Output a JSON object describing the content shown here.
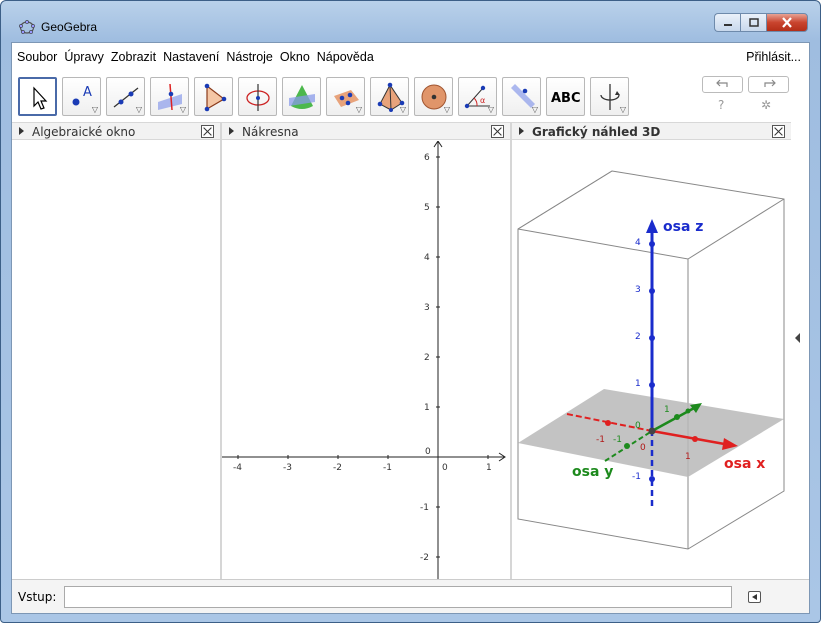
{
  "window": {
    "title": "GeoGebra",
    "icon": "geogebra-logo-icon"
  },
  "menu": {
    "items": [
      "Soubor",
      "Úpravy",
      "Zobrazit",
      "Nastavení",
      "Nástroje",
      "Okno",
      "Nápověda"
    ],
    "login": "Přihlásit..."
  },
  "toolbar": {
    "tools": [
      {
        "icon": "move-arrow-icon",
        "selected": true
      },
      {
        "icon": "point-icon"
      },
      {
        "icon": "line-icon"
      },
      {
        "icon": "perpendicular-line-icon"
      },
      {
        "icon": "polygon-icon"
      },
      {
        "icon": "circle-icon"
      },
      {
        "icon": "intersect-surfaces-icon"
      },
      {
        "icon": "plane-icon"
      },
      {
        "icon": "pyramid-icon"
      },
      {
        "icon": "sphere-icon"
      },
      {
        "icon": "angle-icon"
      },
      {
        "icon": "reflect-icon"
      },
      {
        "icon": "text-icon",
        "label": "ABC"
      },
      {
        "icon": "rotate-view-icon"
      }
    ],
    "undo_icon": "undo-icon",
    "redo_icon": "redo-icon",
    "help_symbol": "?",
    "settings_icon": "gear-icon"
  },
  "panels": {
    "algebra": {
      "title": "Algebraické okno"
    },
    "graphics": {
      "title": "Nákresna"
    },
    "graphics3d": {
      "title": "Grafický náhled 3D"
    }
  },
  "graphics2d": {
    "x_ticks": [
      "-4",
      "-3",
      "-2",
      "-1",
      "0",
      "1"
    ],
    "y_ticks": [
      "6",
      "5",
      "4",
      "3",
      "2",
      "1",
      "0",
      "-1",
      "-2"
    ]
  },
  "graphics3d": {
    "axis_x": "osa x",
    "axis_y": "osa y",
    "axis_z": "osa z",
    "z_ticks": [
      "4",
      "3",
      "2",
      "1",
      "-1"
    ],
    "x_ticks": [
      "-1",
      "0",
      "1"
    ],
    "y_ticks": [
      "-1",
      "0",
      "1"
    ],
    "colors": {
      "x": "#e02020",
      "y": "#1d8a1d",
      "z": "#1a2ccc"
    }
  },
  "input": {
    "label": "Vstup:",
    "value": ""
  }
}
